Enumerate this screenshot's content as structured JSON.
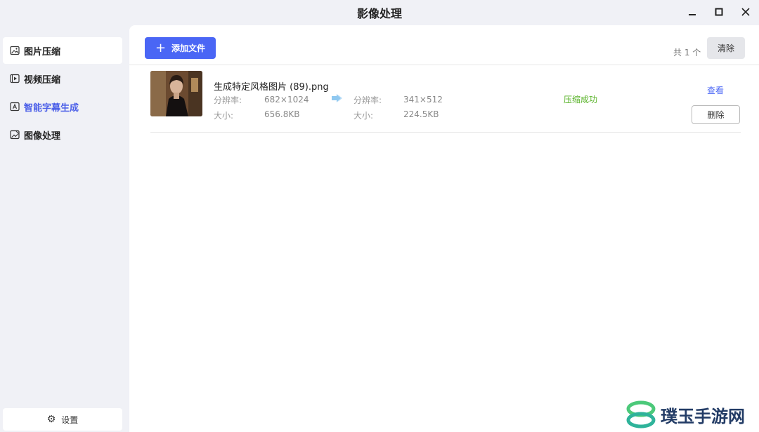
{
  "window": {
    "title": "影像处理"
  },
  "sidebar": {
    "items": [
      {
        "label": "图片压缩"
      },
      {
        "label": "视频压缩"
      },
      {
        "label": "智能字幕生成"
      },
      {
        "label": "图像处理"
      }
    ],
    "settings_label": "设置"
  },
  "toolbar": {
    "add_label": "添加文件",
    "count": "共 1 个",
    "clear_label": "清除"
  },
  "files": [
    {
      "name": "生成特定风格图片 (89).png",
      "res_label": "分辨率:",
      "size_label": "大小:",
      "orig_res": "682×1024",
      "orig_size": "656.8KB",
      "new_res": "341×512",
      "new_size": "224.5KB",
      "status": "压缩成功",
      "view_label": "查看",
      "delete_label": "删除"
    }
  ],
  "watermark": {
    "text": "璞玉手游网"
  },
  "colors": {
    "accent": "#4a66f5",
    "success": "#5ab32a",
    "highlight": "#4a5ee8"
  }
}
